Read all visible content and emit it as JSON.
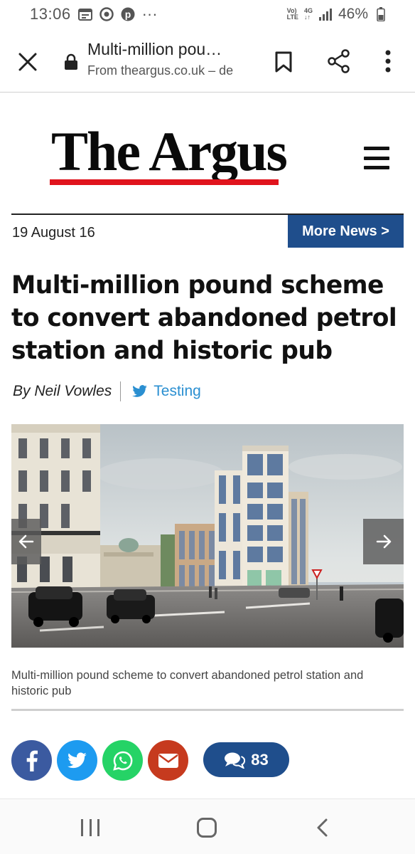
{
  "status_bar": {
    "time": "13:06",
    "network_top": "Vo)",
    "network_bottom": "LTE",
    "gen_top": "4G",
    "gen_bottom": "↓↑",
    "battery": "46%",
    "more_indicator": "···",
    "left_icons": [
      "calendar-icon",
      "chrome-icon",
      "pinterest-icon"
    ],
    "right_icons": [
      "signal-icon",
      "battery-icon"
    ]
  },
  "browser": {
    "page_title": "Multi-million pou…",
    "origin": "From theargus.co.uk – de",
    "icons": [
      "close-icon",
      "lock-icon",
      "bookmark-icon",
      "share-icon",
      "more-vert-icon"
    ]
  },
  "masthead": {
    "logo_text": "The Argus",
    "logo_accent_color": "#e0141d",
    "menu_icon": "hamburger-icon"
  },
  "article": {
    "date": "19 August 16",
    "more_news_label": "More News >",
    "more_news_color": "#1f4e8c",
    "headline": "Multi-million pound scheme to convert abandoned petrol station and historic pub",
    "author": "By Neil Vowles",
    "twitter_handle": "Testing",
    "twitter_color": "#2a8fd1",
    "image_caption": "Multi-million pound scheme to convert abandoned petrol station and historic pub",
    "gallery_icons": [
      "arrow-left-icon",
      "arrow-right-icon"
    ]
  },
  "share": {
    "buttons": [
      {
        "name": "facebook",
        "icon": "facebook-icon",
        "color": "#3b5aa0"
      },
      {
        "name": "twitter",
        "icon": "twitter-icon",
        "color": "#1d9bf0"
      },
      {
        "name": "whatsapp",
        "icon": "whatsapp-icon",
        "color": "#25d366"
      },
      {
        "name": "email",
        "icon": "email-icon",
        "color": "#c63a1e"
      }
    ],
    "comment_count": "83",
    "comment_icon": "comments-icon"
  },
  "nav_bar": {
    "icons": [
      "recents-icon",
      "home-icon",
      "back-icon"
    ]
  }
}
